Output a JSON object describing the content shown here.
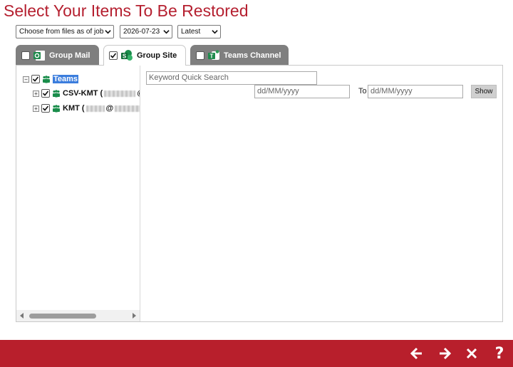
{
  "page_title": "Select Your Items To Be Restored",
  "filters": {
    "source_mode": "Choose from files as of job",
    "date": "2026-07-23",
    "version": "Latest"
  },
  "tabs": [
    {
      "label": "Group Mail",
      "checked": false,
      "active": false
    },
    {
      "label": "Group Site",
      "checked": true,
      "active": true
    },
    {
      "label": "Teams Channel",
      "checked": false,
      "active": false
    }
  ],
  "tree": {
    "root": {
      "label": "Teams",
      "checked": true,
      "expanded": true
    },
    "children": [
      {
        "label": "CSV-KMT (",
        "suffix": "@",
        "checked": true
      },
      {
        "label": "KMT (",
        "suffix": "@",
        "checked": true
      }
    ]
  },
  "search": {
    "keyword_placeholder": "Keyword Quick Search",
    "from_placeholder": "dd/MM/yyyy",
    "to_label": "To",
    "to_placeholder": "dd/MM/yyyy",
    "show_label": "Show"
  },
  "footer": {
    "back_icon": "arrow-left-icon",
    "next_icon": "arrow-right-icon",
    "close_icon": "close-icon",
    "help_icon": "help-icon",
    "help_glyph": "?"
  },
  "colors": {
    "brand_red": "#b81f2c",
    "title_red": "#b52030",
    "tab_gray": "#7f7f7f",
    "selection_blue": "#3b7ddd"
  }
}
